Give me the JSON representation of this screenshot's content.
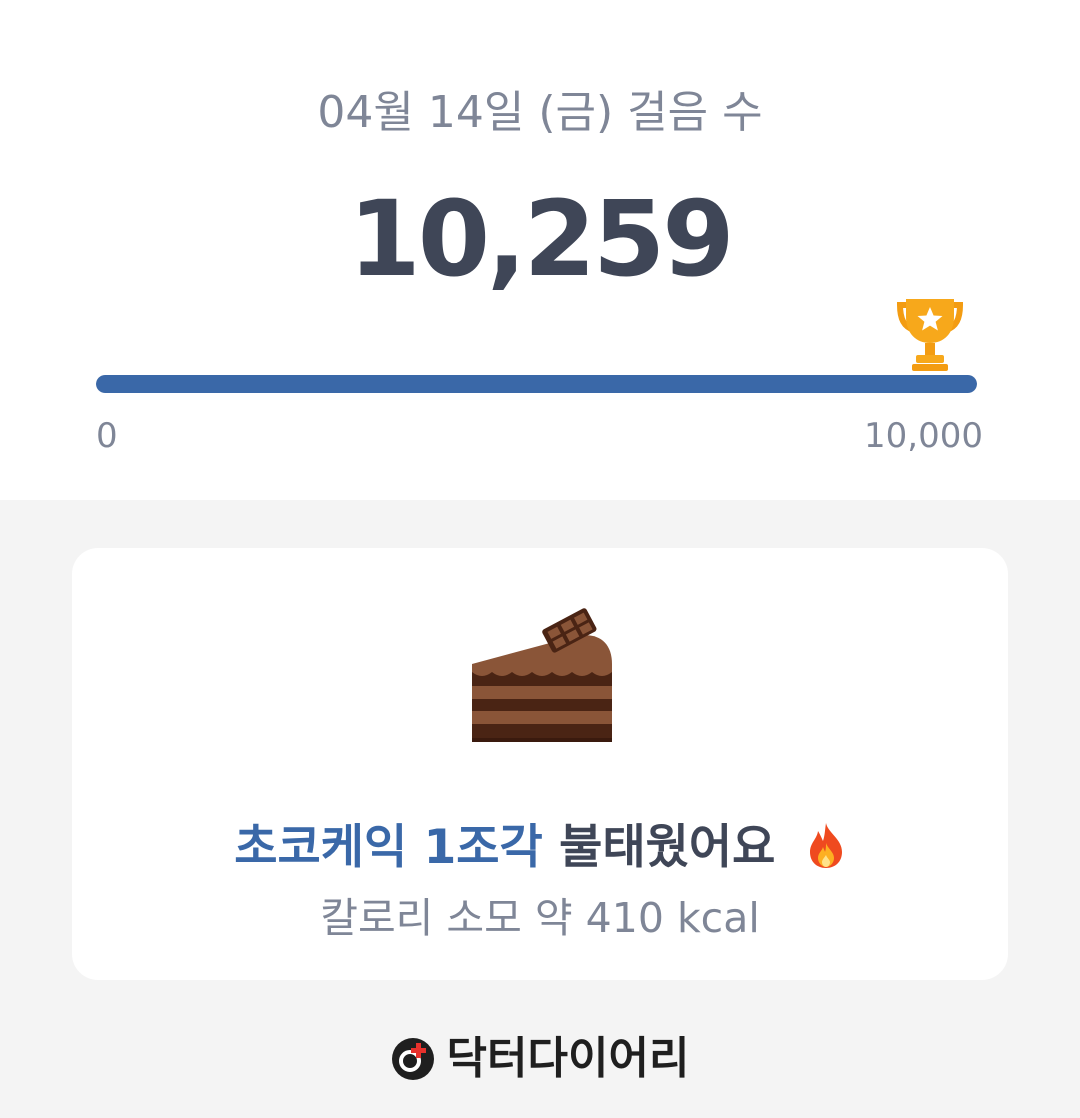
{
  "header": {
    "date_label": "04월 14일 (금) 걸음 수",
    "step_count": "10,259"
  },
  "progress": {
    "min_label": "0",
    "max_label": "10,000",
    "fraction": 1.0,
    "goal_icon": "trophy-icon",
    "fill_color": "#3a68a8"
  },
  "card": {
    "image_icon": "chocolate-cake-icon",
    "headline_highlight": "초코케익 1조각",
    "headline_rest": "불태웠어요",
    "headline_emoji_icon": "fire-icon",
    "calorie_text": "칼로리 소모 약 410 kcal",
    "highlight_color": "#3a68a8"
  },
  "footer": {
    "brand_name": "닥터다이어리",
    "brand_logo_icon": "doctor-diary-logo"
  }
}
